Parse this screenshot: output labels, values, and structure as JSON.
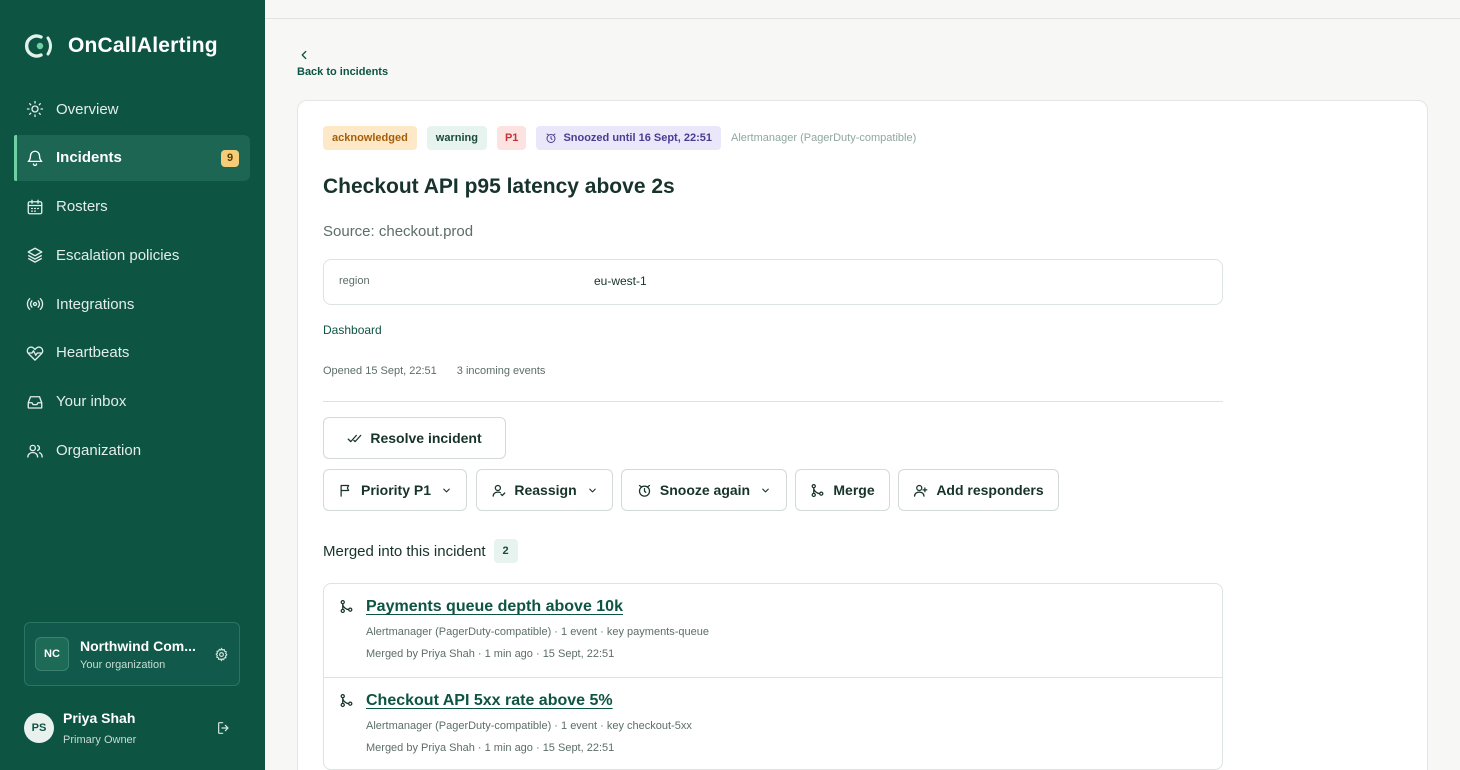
{
  "app": {
    "name": "OnCallAlerting"
  },
  "sidebar": {
    "items": [
      {
        "label": "Overview",
        "icon": "sun-icon"
      },
      {
        "label": "Incidents",
        "icon": "bell-icon",
        "badge": "9",
        "active": true
      },
      {
        "label": "Rosters",
        "icon": "calendar-icon"
      },
      {
        "label": "Escalation policies",
        "icon": "layers-icon"
      },
      {
        "label": "Integrations",
        "icon": "radio-icon"
      },
      {
        "label": "Heartbeats",
        "icon": "heart-pulse-icon"
      },
      {
        "label": "Your inbox",
        "icon": "inbox-icon"
      },
      {
        "label": "Organization",
        "icon": "users-icon"
      }
    ],
    "org": {
      "initials": "NC",
      "name": "Northwind Com...",
      "subtitle": "Your organization"
    },
    "user": {
      "initials": "PS",
      "name": "Priya Shah",
      "role": "Primary Owner"
    }
  },
  "back": {
    "label": "Back to incidents"
  },
  "incident": {
    "badges": {
      "status": "acknowledged",
      "severity": "warning",
      "priority": "P1",
      "snooze": "Snoozed until 16 Sept, 22:51",
      "source": "Alertmanager (PagerDuty-compatible)"
    },
    "title": "Checkout API p95 latency above 2s",
    "source_line": "Source: checkout.prod",
    "labels": [
      {
        "key": "region",
        "value": "eu-west-1"
      }
    ],
    "dashboard_link": "Dashboard",
    "opened": "Opened 15 Sept, 22:51",
    "events": "3 incoming events"
  },
  "actions": {
    "resolve": "Resolve incident",
    "priority": "Priority P1",
    "reassign": "Reassign",
    "snooze": "Snooze again",
    "merge": "Merge",
    "add_responders": "Add responders"
  },
  "merged": {
    "title": "Merged into this incident",
    "count": "2",
    "items": [
      {
        "title": "Payments queue depth above 10k",
        "line1": "Alertmanager (PagerDuty-compatible) · 1 event · key payments-queue",
        "line2": "Merged by Priya Shah · 1 min ago · 15 Sept, 22:51"
      },
      {
        "title": "Checkout API 5xx rate above 5%",
        "line1": "Alertmanager (PagerDuty-compatible) · 1 event · key checkout-5xx",
        "line2": "Merged by Priya Shah · 1 min ago · 15 Sept, 22:51"
      }
    ]
  },
  "colors": {
    "sidebar": "#0d5443",
    "accent": "#6fd0a6",
    "badge_acknowledged": "#fde8c8",
    "badge_priority": "#fde2e2",
    "badge_snooze": "#ebe7fa"
  }
}
